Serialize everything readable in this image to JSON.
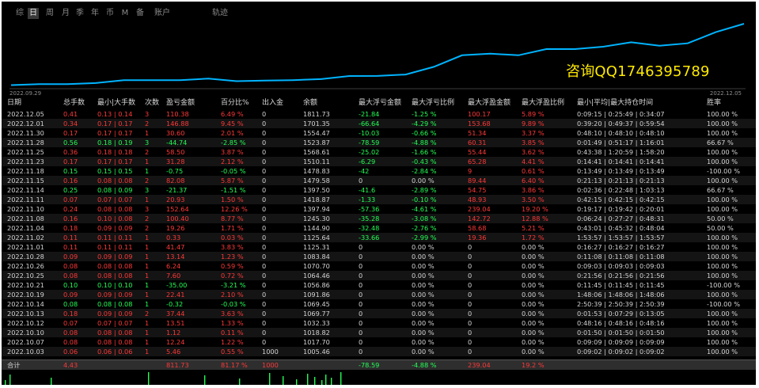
{
  "toolbar": {
    "tabs": [
      "综",
      "日",
      "周",
      "月",
      "季",
      "年",
      "币",
      "M",
      "备",
      "账户",
      "轨迹"
    ],
    "active": "日"
  },
  "chart": {
    "start_date": "2022.09.29",
    "end_date": "2022.12.05",
    "line_color": "#00b4ff",
    "watermark": "咨询QQ1746395789"
  },
  "chart_data": {
    "type": "line",
    "title": "",
    "x": [
      "2022.09.29",
      "2022.10.03",
      "2022.10.07",
      "2022.10.10",
      "2022.10.12",
      "2022.10.13",
      "2022.10.14",
      "2022.10.19",
      "2022.10.21",
      "2022.10.25",
      "2022.10.26",
      "2022.10.28",
      "2022.11.01",
      "2022.11.02",
      "2022.11.04",
      "2022.11.08",
      "2022.11.10",
      "2022.11.11",
      "2022.11.14",
      "2022.11.15",
      "2022.11.18",
      "2022.11.23",
      "2022.11.25",
      "2022.11.28",
      "2022.11.30",
      "2022.12.01",
      "2022.12.05"
    ],
    "series": [
      {
        "values": [
          1005.46,
          1017.7,
          1018.82,
          1032.33,
          1069.77,
          1069.45,
          1069.45,
          1091.86,
          1056.86,
          1064.46,
          1070.7,
          1083.84,
          1125.31,
          1125.64,
          1144.9,
          1245.3,
          1397.94,
          1418.87,
          1397.5,
          1479.58,
          1478.83,
          1510.11,
          1568.61,
          1523.87,
          1554.47,
          1701.35,
          1811.73
        ]
      }
    ]
  },
  "table": {
    "headers": [
      "日期",
      "总手数",
      "最小|大手数",
      "次数",
      "盈亏金额",
      "百分比%",
      "出入金",
      "余额",
      "最大浮亏金额",
      "最大浮亏比例",
      "最大浮盈金额",
      "最大浮盈比例",
      "最小|平均|最大持仓时间",
      "胜率"
    ],
    "rows": [
      [
        "2022.12.05",
        "0.41",
        "0.13 | 0.14",
        "3",
        "110.38",
        "6.49 %",
        "0",
        "1811.73",
        "-21.84",
        "-1.25 %",
        "100.17",
        "5.89 %",
        "0:09:15 | 0:25:49 | 0:34:07",
        "100.00 %"
      ],
      [
        "2022.12.01",
        "0.34",
        "0.17 | 0.17",
        "2",
        "146.88",
        "9.45 %",
        "0",
        "1701.35",
        "-66.64",
        "-4.29 %",
        "153.68",
        "9.89 %",
        "0:39:20 | 0:49:37 | 0:59:54",
        "100.00 %"
      ],
      [
        "2022.11.30",
        "0.17",
        "0.17 | 0.17",
        "1",
        "30.60",
        "2.01 %",
        "0",
        "1554.47",
        "-10.03",
        "-0.66 %",
        "51.34",
        "3.37 %",
        "0:48:10 | 0:48:10 | 0:48:10",
        "100.00 %"
      ],
      [
        "2022.11.28",
        "0.56",
        "0.18 | 0.19",
        "3",
        "-44.74",
        "-2.85 %",
        "0",
        "1523.87",
        "-78.59",
        "-4.88 %",
        "60.31",
        "3.85 %",
        "0:01:49 | 0:51:17 | 1:16:01",
        "66.67 %"
      ],
      [
        "2022.11.25",
        "0.36",
        "0.18 | 0.18",
        "2",
        "58.50",
        "3.87 %",
        "0",
        "1568.61",
        "-25.02",
        "-1.66 %",
        "55.44",
        "3.62 %",
        "0:43:38 | 1:20:59 | 1:58:20",
        "100.00 %"
      ],
      [
        "2022.11.23",
        "0.17",
        "0.17 | 0.17",
        "1",
        "31.28",
        "2.12 %",
        "0",
        "1510.11",
        "-6.29",
        "-0.43 %",
        "65.28",
        "4.41 %",
        "0:14:41 | 0:14:41 | 0:14:41",
        "100.00 %"
      ],
      [
        "2022.11.18",
        "0.15",
        "0.15 | 0.15",
        "1",
        "-0.75",
        "-0.05 %",
        "0",
        "1478.83",
        "-42",
        "-2.84 %",
        "9",
        "0.61 %",
        "0:13:49 | 0:13:49 | 0:13:49",
        "-100.00 %"
      ],
      [
        "2022.11.15",
        "0.16",
        "0.08 | 0.08",
        "2",
        "82.08",
        "5.87 %",
        "0",
        "1479.58",
        "0",
        "0.00 %",
        "89.44",
        "6.40 %",
        "0:21:13 | 0:21:13 | 0:21:13",
        "100.00 %"
      ],
      [
        "2022.11.14",
        "0.25",
        "0.08 | 0.09",
        "3",
        "-21.37",
        "-1.51 %",
        "0",
        "1397.50",
        "-41.6",
        "-2.89 %",
        "54.75",
        "3.86 %",
        "0:02:36 | 0:22:48 | 1:03:13",
        "66.67 %"
      ],
      [
        "2022.11.11",
        "0.07",
        "0.07 | 0.07",
        "1",
        "20.93",
        "1.50 %",
        "0",
        "1418.87",
        "-1.33",
        "-0.10 %",
        "48.93",
        "3.50 %",
        "0:42:15 | 0:42:15 | 0:42:15",
        "100.00 %"
      ],
      [
        "2022.11.10",
        "0.24",
        "0.08 | 0.08",
        "3",
        "152.64",
        "12.26 %",
        "0",
        "1397.94",
        "-57.36",
        "-4.61 %",
        "239.04",
        "19.20 %",
        "0:19:17 | 0:19:42 | 0:20:01",
        "100.00 %"
      ],
      [
        "2022.11.08",
        "0.16",
        "0.10 | 0.08",
        "2",
        "100.40",
        "8.77 %",
        "0",
        "1245.30",
        "-35.28",
        "-3.08 %",
        "142.72",
        "12.88 %",
        "0:06:24 | 0:27:27 | 0:48:31",
        "50.00 %"
      ],
      [
        "2022.11.04",
        "0.18",
        "0.09 | 0.09",
        "2",
        "19.26",
        "1.71 %",
        "0",
        "1144.90",
        "-32.48",
        "-2.76 %",
        "58.68",
        "5.21 %",
        "0:43:01 | 0:45:32 | 0:48:04",
        "50.00 %"
      ],
      [
        "2022.11.02",
        "0.11",
        "0.11 | 0.11",
        "1",
        "0.33",
        "0.03 %",
        "0",
        "1125.64",
        "-33.66",
        "-2.99 %",
        "19.36",
        "1.72 %",
        "1:53:57 | 1:53:57 | 1:53:57",
        "100.00 %"
      ],
      [
        "2022.11.01",
        "0.11",
        "0.11 | 0.11",
        "1",
        "41.47",
        "3.83 %",
        "0",
        "1125.31",
        "0",
        "0.00 %",
        "0",
        "0.00 %",
        "0:16:27 | 0:16:27 | 0:16:27",
        "100.00 %"
      ],
      [
        "2022.10.28",
        "0.09",
        "0.09 | 0.09",
        "1",
        "13.14",
        "1.23 %",
        "0",
        "1083.84",
        "0",
        "0.00 %",
        "0",
        "0.00 %",
        "0:11:08 | 0:11:08 | 0:11:08",
        "100.00 %"
      ],
      [
        "2022.10.26",
        "0.08",
        "0.08 | 0.08",
        "1",
        "6.24",
        "0.59 %",
        "0",
        "1070.70",
        "0",
        "0.00 %",
        "0",
        "0.00 %",
        "0:09:03 | 0:09:03 | 0:09:03",
        "100.00 %"
      ],
      [
        "2022.10.25",
        "0.08",
        "0.08 | 0.08",
        "1",
        "7.60",
        "0.72 %",
        "0",
        "1064.46",
        "0",
        "0.00 %",
        "0",
        "0.00 %",
        "0:21:56 | 0:21:56 | 0:21:56",
        "100.00 %"
      ],
      [
        "2022.10.21",
        "0.10",
        "0.10 | 0.10",
        "1",
        "-35.00",
        "-3.21 %",
        "0",
        "1056.86",
        "0",
        "0.00 %",
        "0",
        "0.00 %",
        "0:11:45 | 0:11:45 | 0:11:45",
        "-100.00 %"
      ],
      [
        "2022.10.19",
        "0.09",
        "0.09 | 0.09",
        "1",
        "22.41",
        "2.10 %",
        "0",
        "1091.86",
        "0",
        "0.00 %",
        "0",
        "0.00 %",
        "1:48:06 | 1:48:06 | 1:48:06",
        "100.00 %"
      ],
      [
        "2022.10.14",
        "0.08",
        "0.08 | 0.08",
        "1",
        "-0.32",
        "-0.03 %",
        "0",
        "1069.45",
        "0",
        "0.00 %",
        "0",
        "0.00 %",
        "2:50:39 | 2:50:39 | 2:50:39",
        "-100.00 %"
      ],
      [
        "2022.10.13",
        "0.18",
        "0.09 | 0.09",
        "2",
        "37.44",
        "3.63 %",
        "0",
        "1069.77",
        "0",
        "0.00 %",
        "0",
        "0.00 %",
        "0:01:53 | 0:07:29 | 0:13:05",
        "100.00 %"
      ],
      [
        "2022.10.12",
        "0.07",
        "0.07 | 0.07",
        "1",
        "13.51",
        "1.33 %",
        "0",
        "1032.33",
        "0",
        "0.00 %",
        "0",
        "0.00 %",
        "0:48:16 | 0:48:16 | 0:48:16",
        "100.00 %"
      ],
      [
        "2022.10.10",
        "0.08",
        "0.08 | 0.08",
        "1",
        "1.12",
        "0.11 %",
        "0",
        "1018.82",
        "0",
        "0.00 %",
        "0",
        "0.00 %",
        "0:01:50 | 0:01:50 | 0:01:50",
        "100.00 %"
      ],
      [
        "2022.10.07",
        "0.08",
        "0.08 | 0.08",
        "1",
        "12.24",
        "1.22 %",
        "0",
        "1017.70",
        "0",
        "0.00 %",
        "0",
        "0.00 %",
        "0:09:09 | 0:09:09 | 0:09:09",
        "100.00 %"
      ],
      [
        "2022.10.03",
        "0.06",
        "0.06 | 0.06",
        "1",
        "5.46",
        "0.55 %",
        "1000",
        "1005.46",
        "0",
        "0.00 %",
        "0",
        "0.00 %",
        "0:09:02 | 0:09:02 | 0:09:02",
        "100.00 %"
      ]
    ],
    "total": [
      "合计",
      "4.43",
      "",
      "",
      "811.73",
      "81.17 %",
      "1000",
      "",
      "-78.59",
      "-4.88 %",
      "239.04",
      "19.2 %",
      "",
      ""
    ]
  },
  "colors": {
    "positive": "#ff3838",
    "negative": "#22ff55",
    "neutral": "#d4d4d4",
    "volume": "#22ff55"
  }
}
